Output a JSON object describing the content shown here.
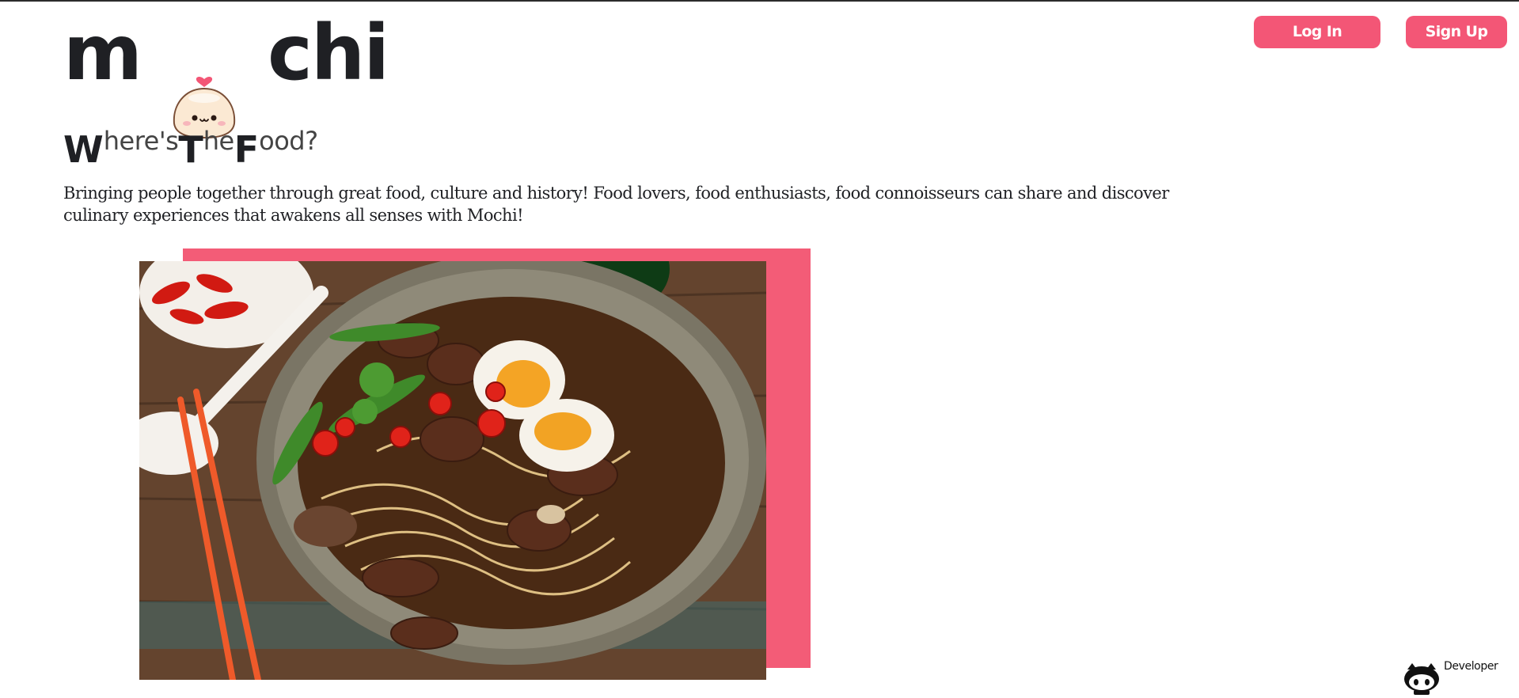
{
  "logo": {
    "left_text": "m",
    "right_text": "chi",
    "mascot_icon": "mochi-dumpling-with-heart"
  },
  "tagline": {
    "w_big": "W",
    "w_rest": "here's",
    "t_big": "T",
    "t_rest": "he",
    "f_big": "F",
    "f_rest": "ood?"
  },
  "description": "Bringing people together through great food, culture and history! Food lovers, food enthusiasts, food connoisseurs can share and discover culinary experiences that awakens all senses with Mochi!",
  "nav": {
    "login_label": "Log In",
    "signup_label": "Sign Up"
  },
  "hero": {
    "image_icon": "ramen-bowl-photo"
  },
  "footer": {
    "developer_label": "Developer",
    "developer_icon": "github-octocat-icon"
  },
  "colors": {
    "accent": "#f35676",
    "text": "#1f2024",
    "background": "#ffffff"
  }
}
